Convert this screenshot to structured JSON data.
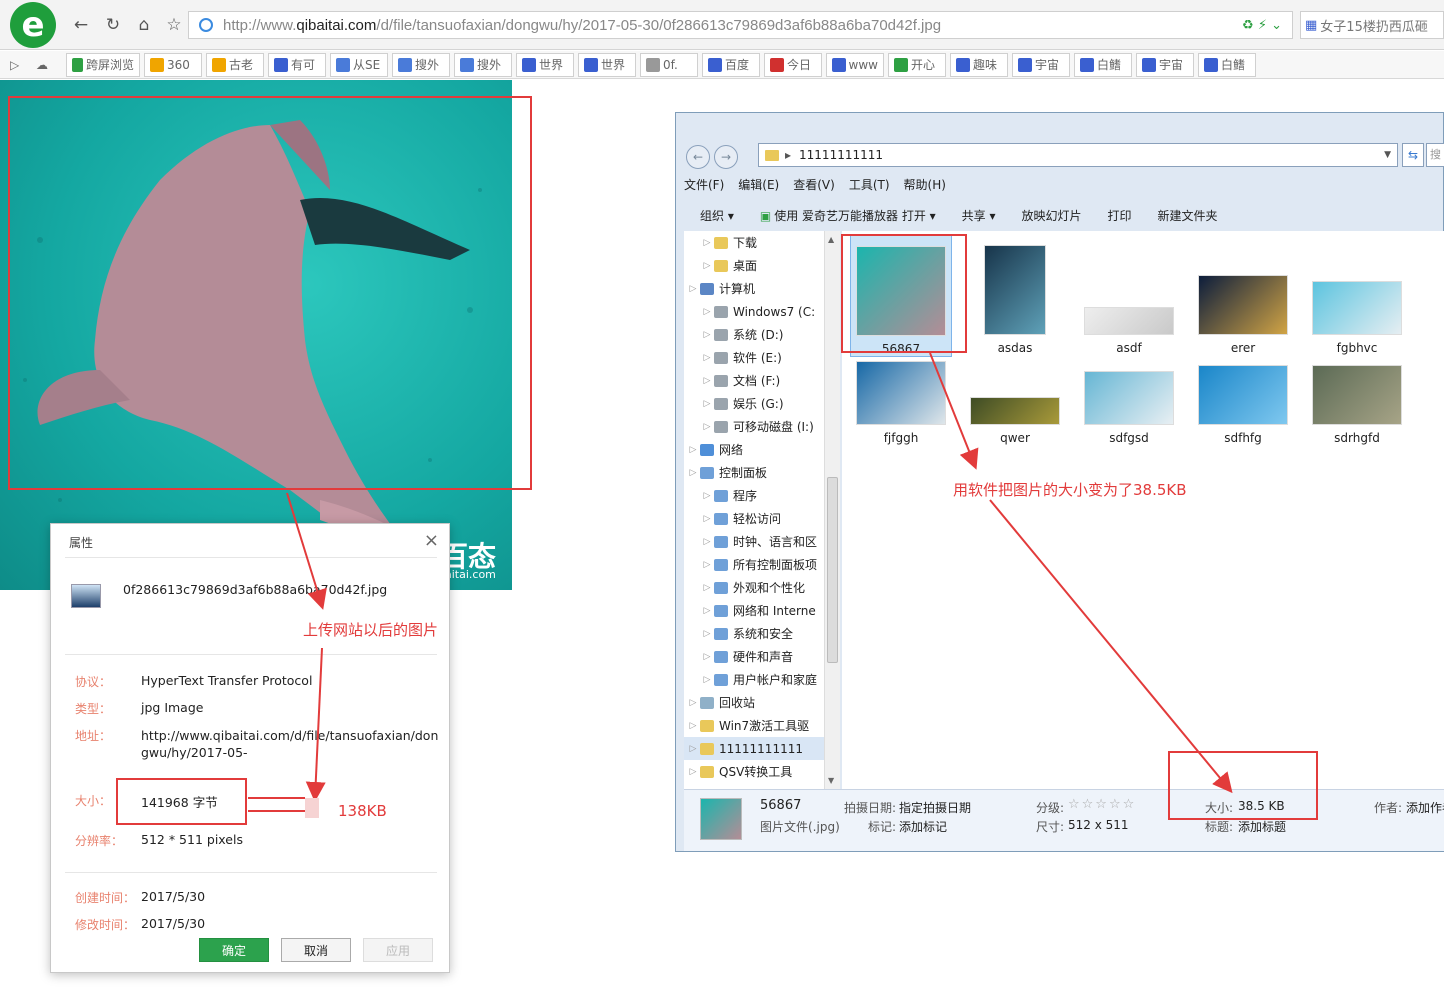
{
  "browser": {
    "url_gray": "http://www.",
    "url_dark": "qibaitai.com",
    "url_rest": "/d/file/tansuofaxian/dongwu/hy/2017-05-30/0f286613c79869d3af6b88a6ba70d42f.jpg",
    "search_text": "女子15楼扔西瓜砸",
    "favorites": [
      {
        "label": "跨屏浏览",
        "icon_color": "#2ea043"
      },
      {
        "label": "360",
        "icon_color": "#f0a500"
      },
      {
        "label": "古老",
        "icon_color": "#f0a500"
      },
      {
        "label": "有可",
        "icon_color": "#3a5fd0"
      },
      {
        "label": "从SE",
        "icon_color": "#4a7bd9"
      },
      {
        "label": "搜外",
        "icon_color": "#4a7bd9"
      },
      {
        "label": "搜外",
        "icon_color": "#4a7bd9"
      },
      {
        "label": "世界",
        "icon_color": "#3a5fd0"
      },
      {
        "label": "世界",
        "icon_color": "#3a5fd0"
      },
      {
        "label": "0f.",
        "icon_color": "#999999"
      },
      {
        "label": "百度",
        "icon_color": "#3a5fd0"
      },
      {
        "label": "今日",
        "icon_color": "#d0302f"
      },
      {
        "label": "www",
        "icon_color": "#3a5fd0"
      },
      {
        "label": "开心",
        "icon_color": "#2ea043"
      },
      {
        "label": "趣味",
        "icon_color": "#3a5fd0"
      },
      {
        "label": "宇宙",
        "icon_color": "#3a5fd0"
      },
      {
        "label": "白鳍",
        "icon_color": "#3a5fd0"
      },
      {
        "label": "宇宙",
        "icon_color": "#3a5fd0"
      },
      {
        "label": "白鳍",
        "icon_color": "#3a5fd0"
      }
    ]
  },
  "photo": {
    "watermark": "百态",
    "watermark_url": "aitai.com"
  },
  "dialog": {
    "title": "属性",
    "filename": "0f286613c79869d3af6b88a6ba70d42f.jpg",
    "protocol_label": "协议：",
    "protocol": "HyperText Transfer Protocol",
    "type_label": "类型：",
    "type": "jpg Image",
    "address_label": "地址：",
    "address": "http://www.qibaitai.com/d/file/tansuofaxian/dongwu/hy/2017-05-",
    "size_label": "大小：",
    "size": "141968 字节",
    "resolution_label": "分辨率：",
    "resolution": "512 * 511 pixels",
    "created_label": "创建时间：",
    "created": "2017/5/30",
    "modified_label": "修改时间：",
    "modified": "2017/5/30",
    "ok": "确定",
    "cancel": "取消",
    "apply": "应用"
  },
  "annotations": {
    "uploaded": "上传网站以后的图片",
    "size_kb": "138KB",
    "resized": "用软件把图片的大小变为了38.5KB"
  },
  "explorer": {
    "path": "11111111111",
    "search_placeholder": "搜索",
    "menu": [
      "文件(F)",
      "编辑(E)",
      "查看(V)",
      "工具(T)",
      "帮助(H)"
    ],
    "toolbar": [
      "组织 ▾",
      "使用 爱奇艺万能播放器 打开 ▾",
      "共享 ▾",
      "放映幻灯片",
      "打印",
      "新建文件夹"
    ],
    "tree": [
      {
        "label": "下载",
        "indent": 1,
        "icon": "folder"
      },
      {
        "label": "桌面",
        "indent": 1,
        "icon": "folder"
      },
      {
        "label": "计算机",
        "indent": 0,
        "icon": "computer"
      },
      {
        "label": "Windows7 (C:",
        "indent": 1,
        "icon": "drive"
      },
      {
        "label": "系统 (D:)",
        "indent": 1,
        "icon": "drive"
      },
      {
        "label": "软件 (E:)",
        "indent": 1,
        "icon": "drive"
      },
      {
        "label": "文档 (F:)",
        "indent": 1,
        "icon": "drive"
      },
      {
        "label": "娱乐 (G:)",
        "indent": 1,
        "icon": "drive"
      },
      {
        "label": "可移动磁盘 (I:)",
        "indent": 1,
        "icon": "drive"
      },
      {
        "label": "网络",
        "indent": 0,
        "icon": "network"
      },
      {
        "label": "控制面板",
        "indent": 0,
        "icon": "panel"
      },
      {
        "label": "程序",
        "indent": 1,
        "icon": "panel"
      },
      {
        "label": "轻松访问",
        "indent": 1,
        "icon": "panel"
      },
      {
        "label": "时钟、语言和区",
        "indent": 1,
        "icon": "panel"
      },
      {
        "label": "所有控制面板项",
        "indent": 1,
        "icon": "panel"
      },
      {
        "label": "外观和个性化",
        "indent": 1,
        "icon": "panel"
      },
      {
        "label": "网络和 Interne",
        "indent": 1,
        "icon": "panel"
      },
      {
        "label": "系统和安全",
        "indent": 1,
        "icon": "panel"
      },
      {
        "label": "硬件和声音",
        "indent": 1,
        "icon": "panel"
      },
      {
        "label": "用户帐户和家庭",
        "indent": 1,
        "icon": "panel"
      },
      {
        "label": "回收站",
        "indent": 0,
        "icon": "bin"
      },
      {
        "label": "Win7激活工具驱",
        "indent": 0,
        "icon": "folder"
      },
      {
        "label": "11111111111",
        "indent": 0,
        "icon": "folder",
        "selected": true
      },
      {
        "label": "QSV转换工具",
        "indent": 0,
        "icon": "folder"
      }
    ],
    "files": [
      {
        "name": "56867",
        "colors": [
          "#1bb5ad",
          "#b48d96"
        ],
        "selected": true
      },
      {
        "name": "asdas",
        "colors": [
          "#17344a",
          "#5fa1b8"
        ]
      },
      {
        "name": "asdf",
        "colors": [
          "#eeeeee",
          "#c9c9c9"
        ]
      },
      {
        "name": "erer",
        "colors": [
          "#0c1d3c",
          "#d1a445"
        ]
      },
      {
        "name": "fgbhvc",
        "colors": [
          "#5cc4df",
          "#e6eef2"
        ]
      },
      {
        "name": "fjfggh",
        "colors": [
          "#1768a6",
          "#dfe6ea"
        ]
      },
      {
        "name": "qwer",
        "colors": [
          "#3e4c25",
          "#a99a3a"
        ]
      },
      {
        "name": "sdfgsd",
        "colors": [
          "#66b6d4",
          "#e8eff3"
        ]
      },
      {
        "name": "sdfhfg",
        "colors": [
          "#1a86c9",
          "#7fc8ef"
        ]
      },
      {
        "name": "sdrhgfd",
        "colors": [
          "#5b6a55",
          "#a7a487"
        ]
      }
    ],
    "status": {
      "name": "56867",
      "kind": "图片文件(.jpg)",
      "date_label": "拍摄日期:",
      "date": "指定拍摄日期",
      "tag_label": "标记:",
      "tag": "添加标记",
      "rating_label": "分级:",
      "rating": 0,
      "dims_label": "尺寸:",
      "dims": "512 x 511",
      "size_label": "大小:",
      "size": "38.5 KB",
      "title_label": "标题:",
      "title": "添加标题",
      "author_label": "作者:",
      "author": "添加作者"
    }
  }
}
